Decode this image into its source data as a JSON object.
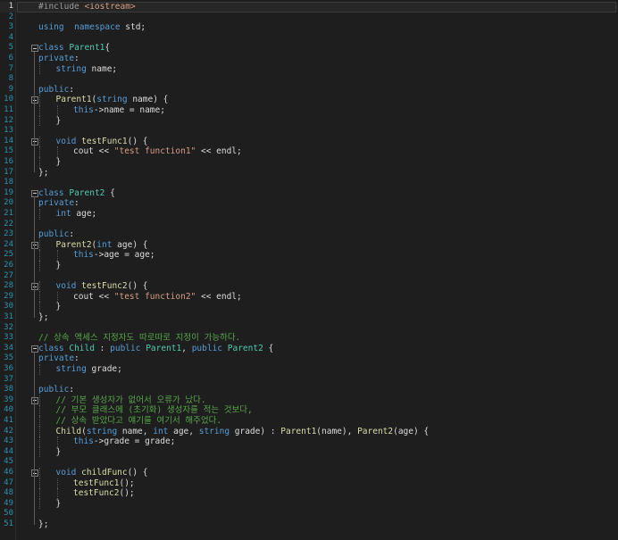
{
  "editor": {
    "colors": {
      "background": "#1e1e1e",
      "line_number": "#2b91af",
      "keyword": "#569cd6",
      "type": "#4ec9b0",
      "function": "#dcdcaa",
      "comment": "#57a64a",
      "string": "#d69d85"
    },
    "current_line": 1,
    "lines": [
      {
        "n": "1",
        "indent": 0,
        "tokens": [
          [
            "pp",
            "#include "
          ],
          [
            "inc",
            "<iostream>"
          ]
        ]
      },
      {
        "n": "2",
        "indent": 0,
        "tokens": []
      },
      {
        "n": "3",
        "indent": 0,
        "tokens": [
          [
            "kw",
            "using"
          ],
          [
            "",
            "  "
          ],
          [
            "kw",
            "namespace"
          ],
          [
            "",
            " std;"
          ]
        ]
      },
      {
        "n": "4",
        "indent": 0,
        "tokens": []
      },
      {
        "n": "5",
        "indent": 0,
        "fold": true,
        "tokens": [
          [
            "kw",
            "class"
          ],
          [
            "",
            " "
          ],
          [
            "ty",
            "Parent1"
          ],
          [
            "",
            "{"
          ]
        ]
      },
      {
        "n": "6",
        "indent": 0,
        "tokens": [
          [
            "kw",
            "private"
          ],
          [
            "",
            ":"
          ]
        ]
      },
      {
        "n": "7",
        "indent": 1,
        "tokens": [
          [
            "kw",
            "string"
          ],
          [
            "",
            " name;"
          ]
        ]
      },
      {
        "n": "8",
        "indent": 0,
        "tokens": []
      },
      {
        "n": "9",
        "indent": 0,
        "tokens": [
          [
            "kw",
            "public"
          ],
          [
            "",
            ":"
          ]
        ]
      },
      {
        "n": "10",
        "indent": 1,
        "fold": true,
        "tokens": [
          [
            "fn",
            "Parent1"
          ],
          [
            "",
            "("
          ],
          [
            "kw",
            "string"
          ],
          [
            "",
            " name) {"
          ]
        ]
      },
      {
        "n": "11",
        "indent": 2,
        "tokens": [
          [
            "kw",
            "this"
          ],
          [
            "",
            "->name = name;"
          ]
        ]
      },
      {
        "n": "12",
        "indent": 1,
        "tokens": [
          [
            "",
            "}"
          ]
        ]
      },
      {
        "n": "13",
        "indent": 0,
        "tokens": []
      },
      {
        "n": "14",
        "indent": 1,
        "fold": true,
        "tokens": [
          [
            "kw",
            "void"
          ],
          [
            "",
            " "
          ],
          [
            "fn",
            "testFunc1"
          ],
          [
            "",
            "() {"
          ]
        ]
      },
      {
        "n": "15",
        "indent": 2,
        "tokens": [
          [
            "",
            "cout << "
          ],
          [
            "st",
            "\"test function1\""
          ],
          [
            "",
            " << endl;"
          ]
        ]
      },
      {
        "n": "16",
        "indent": 1,
        "tokens": [
          [
            "",
            "}"
          ]
        ]
      },
      {
        "n": "17",
        "indent": 0,
        "tokens": [
          [
            "",
            "};"
          ]
        ]
      },
      {
        "n": "18",
        "indent": 0,
        "tokens": []
      },
      {
        "n": "19",
        "indent": 0,
        "fold": true,
        "tokens": [
          [
            "kw",
            "class"
          ],
          [
            "",
            " "
          ],
          [
            "ty",
            "Parent2"
          ],
          [
            "",
            " {"
          ]
        ]
      },
      {
        "n": "20",
        "indent": 0,
        "tokens": [
          [
            "kw",
            "private"
          ],
          [
            "",
            ":"
          ]
        ]
      },
      {
        "n": "21",
        "indent": 1,
        "tokens": [
          [
            "kw",
            "int"
          ],
          [
            "",
            " age;"
          ]
        ]
      },
      {
        "n": "22",
        "indent": 0,
        "tokens": []
      },
      {
        "n": "23",
        "indent": 0,
        "tokens": [
          [
            "kw",
            "public"
          ],
          [
            "",
            ":"
          ]
        ]
      },
      {
        "n": "24",
        "indent": 1,
        "fold": true,
        "tokens": [
          [
            "fn",
            "Parent2"
          ],
          [
            "",
            "("
          ],
          [
            "kw",
            "int"
          ],
          [
            "",
            " age) {"
          ]
        ]
      },
      {
        "n": "25",
        "indent": 2,
        "tokens": [
          [
            "kw",
            "this"
          ],
          [
            "",
            "->age = age;"
          ]
        ]
      },
      {
        "n": "26",
        "indent": 1,
        "tokens": [
          [
            "",
            "}"
          ]
        ]
      },
      {
        "n": "27",
        "indent": 0,
        "tokens": []
      },
      {
        "n": "28",
        "indent": 1,
        "fold": true,
        "tokens": [
          [
            "kw",
            "void"
          ],
          [
            "",
            " "
          ],
          [
            "fn",
            "testFunc2"
          ],
          [
            "",
            "() {"
          ]
        ]
      },
      {
        "n": "29",
        "indent": 2,
        "tokens": [
          [
            "",
            "cout << "
          ],
          [
            "st",
            "\"test function2\""
          ],
          [
            "",
            " << endl;"
          ]
        ]
      },
      {
        "n": "30",
        "indent": 1,
        "tokens": [
          [
            "",
            "}"
          ]
        ]
      },
      {
        "n": "31",
        "indent": 0,
        "tokens": [
          [
            "",
            "};"
          ]
        ]
      },
      {
        "n": "32",
        "indent": 0,
        "tokens": []
      },
      {
        "n": "33",
        "indent": 0,
        "tokens": [
          [
            "cm",
            "// 상속 액세스 지정자도 따로따로 지정이 가능하다."
          ]
        ]
      },
      {
        "n": "34",
        "indent": 0,
        "fold": true,
        "tokens": [
          [
            "kw",
            "class"
          ],
          [
            "",
            " "
          ],
          [
            "ty",
            "Child"
          ],
          [
            "",
            " : "
          ],
          [
            "kw",
            "public"
          ],
          [
            "",
            " "
          ],
          [
            "ty",
            "Parent1"
          ],
          [
            "",
            ", "
          ],
          [
            "kw",
            "public"
          ],
          [
            "",
            " "
          ],
          [
            "ty",
            "Parent2"
          ],
          [
            "",
            " {"
          ]
        ]
      },
      {
        "n": "35",
        "indent": 0,
        "tokens": [
          [
            "kw",
            "private"
          ],
          [
            "",
            ":"
          ]
        ]
      },
      {
        "n": "36",
        "indent": 1,
        "tokens": [
          [
            "kw",
            "string"
          ],
          [
            "",
            " grade;"
          ]
        ]
      },
      {
        "n": "37",
        "indent": 0,
        "tokens": []
      },
      {
        "n": "38",
        "indent": 0,
        "tokens": [
          [
            "kw",
            "public"
          ],
          [
            "",
            ":"
          ]
        ]
      },
      {
        "n": "39",
        "indent": 1,
        "fold": true,
        "tokens": [
          [
            "cm",
            "// 기본 생성자가 없어서 오류가 났다."
          ]
        ]
      },
      {
        "n": "40",
        "indent": 1,
        "tokens": [
          [
            "cm",
            "// 부모 클래스에 (초기화) 생성자를 적는 것보다,"
          ]
        ]
      },
      {
        "n": "41",
        "indent": 1,
        "tokens": [
          [
            "cm",
            "// 상속 받았다고 얘기를 여기서 해주었다."
          ]
        ]
      },
      {
        "n": "42",
        "indent": 1,
        "tokens": [
          [
            "fn",
            "Child"
          ],
          [
            "",
            "("
          ],
          [
            "kw",
            "string"
          ],
          [
            "",
            " name, "
          ],
          [
            "kw",
            "int"
          ],
          [
            "",
            " age, "
          ],
          [
            "kw",
            "string"
          ],
          [
            "",
            " grade) : "
          ],
          [
            "fn",
            "Parent1"
          ],
          [
            "",
            "(name), "
          ],
          [
            "fn",
            "Parent2"
          ],
          [
            "",
            "(age) {"
          ]
        ]
      },
      {
        "n": "43",
        "indent": 2,
        "tokens": [
          [
            "kw",
            "this"
          ],
          [
            "",
            "->grade = grade;"
          ]
        ]
      },
      {
        "n": "44",
        "indent": 1,
        "tokens": [
          [
            "",
            "}"
          ]
        ]
      },
      {
        "n": "45",
        "indent": 0,
        "tokens": []
      },
      {
        "n": "46",
        "indent": 1,
        "fold": true,
        "tokens": [
          [
            "kw",
            "void"
          ],
          [
            "",
            " "
          ],
          [
            "fn",
            "childFunc"
          ],
          [
            "",
            "() {"
          ]
        ]
      },
      {
        "n": "47",
        "indent": 2,
        "tokens": [
          [
            "fn",
            "testFunc1"
          ],
          [
            "",
            "();"
          ]
        ]
      },
      {
        "n": "48",
        "indent": 2,
        "tokens": [
          [
            "fn",
            "testFunc2"
          ],
          [
            "",
            "();"
          ]
        ]
      },
      {
        "n": "49",
        "indent": 1,
        "tokens": [
          [
            "",
            "}"
          ]
        ]
      },
      {
        "n": "50",
        "indent": 0,
        "tokens": []
      },
      {
        "n": "51",
        "indent": 0,
        "tokens": [
          [
            "",
            "};"
          ]
        ]
      }
    ]
  }
}
